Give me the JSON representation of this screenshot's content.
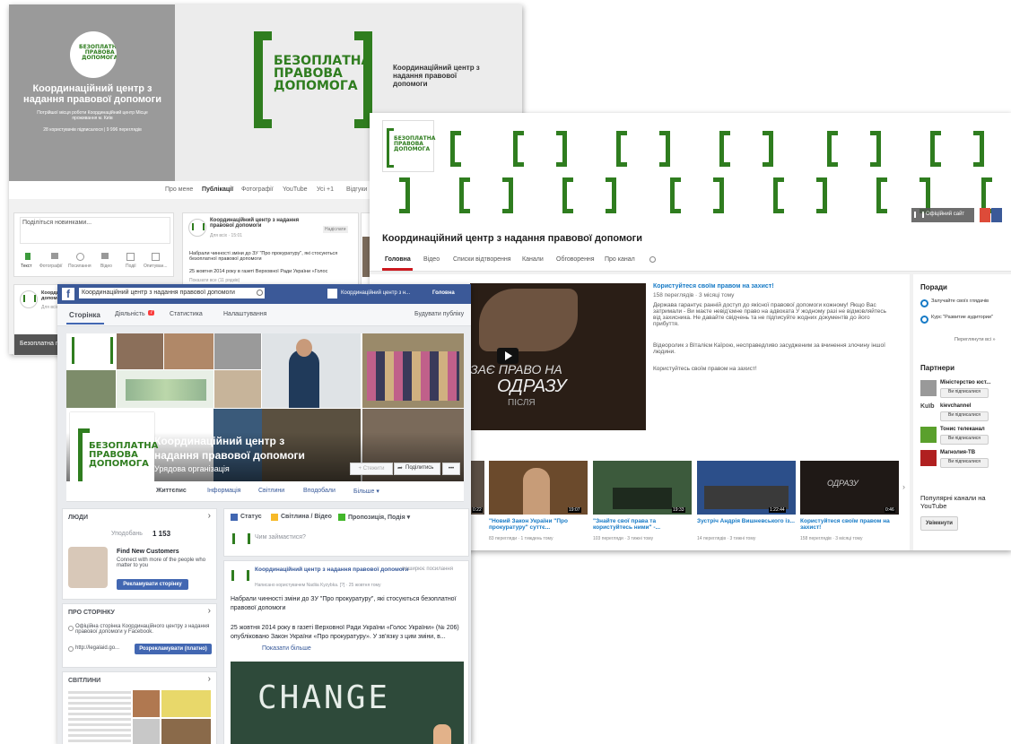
{
  "gplus": {
    "page_title": "Координаційний центр з надання правової допомоги",
    "desc": "Потрійшої місця роботи Координаційний центр Місце проживання м. Київ",
    "stats": "28 користувачів підписалося | 9 996 переглядів",
    "logo": [
      "БЕЗОПЛАТНА",
      "ПРАВОВА",
      "ДОПОМОГА"
    ],
    "banner_caption": "Координаційний центр з надання правової допомоги",
    "tabs": [
      "Про мене",
      "Публікації",
      "Фотографії",
      "YouTube",
      "Усі +1",
      "Відгуки"
    ],
    "share_placeholder": "Поділіться новинками...",
    "share_tools": [
      "Текст",
      "Фотографії",
      "Посилання",
      "Відео",
      "Події",
      "Опитуван..."
    ],
    "post_author": "Координаційний центр з надання правової допомоги",
    "post_meta": "Для всіх · 15:01",
    "post_badge": "Надіслати",
    "post_text1": "Набрали чинності зміни до ЗУ \"Про прокуратуру\", які стосуються безоплатної правової допомоги",
    "post_text2": "25 жовтня 2014 року в газеті Верховної Ради України «Голос",
    "post_more": "Показати все (11 рядків)",
    "side_item": "Координаційний центр з надання правової допомоги",
    "side_meta": "Для всіх",
    "side_caption": "Безоплатна пр..."
  },
  "youtube": {
    "channel_title": "Координаційний центр з надання правової допомоги",
    "official_site": "Офіційний сайт",
    "tabs": [
      "Головна",
      "Відео",
      "Списки відтворення",
      "Канали",
      "Обговорення",
      "Про канал"
    ],
    "video_title": "Користуйтеся своїм правом на захист!",
    "video_meta": "158 переглядів · 3 місяці тому",
    "video_desc1": "Держава гарантує ранній доступ до якісної правової допомоги кожному! Якщо Вас затримали - Ви маєте невід'ємне право на адвоката У жодному разі не відмовляйтесь від захисника. Не давайте свідчень та не підписуйте жодних документів до його прибуття.",
    "video_desc2": "Відеоролик з Віталієм Каїрою, несправедливо засудженим за вчинення злочину іншої людини.",
    "video_desc3": "Користуйтесь своїм правом на захист!",
    "player_overlay": [
      "ЗАЄ ПРАВО НА",
      "ОДРАЗУ",
      "ПІСЛЯ"
    ],
    "thumbs": [
      {
        "title": "\"Новий Закон України \"Про прокуратуру\" суттє...",
        "meta": "83 перегляди · 1 тиждень тому",
        "duration": "19:07"
      },
      {
        "title": "\"Знайте свої права та користуйтесь ними\" -...",
        "meta": "103 перегляди · 3 тижні тому",
        "duration": "19:33"
      },
      {
        "title": "Зустріч Андрія Вишневського із...",
        "meta": "14 переглядів · 3 тижні тому",
        "duration": "1:22:44"
      },
      {
        "title": "Користуйтеся своїм правом на захист!",
        "meta": "158 переглядів · 3 місяці тому",
        "duration": "0:46"
      }
    ],
    "first_thumb_duration": "0:22",
    "tips_title": "Поради",
    "tips": [
      "Залучайте своїх глядачів",
      "Курс \"Развитие аудитории\""
    ],
    "tips_more": "Переглянути всі »",
    "partners_title": "Партнери",
    "partners": [
      {
        "name": "Міністерство юст...",
        "btn": "Ви підписалися"
      },
      {
        "name": "kievchannel",
        "btn": "Ви підписалися"
      },
      {
        "name": "Тонис телеканал",
        "btn": "Ви підписалися"
      },
      {
        "name": "Магнолия-ТВ",
        "btn": "Ви підписалися"
      }
    ],
    "popular_title": "Популярні канали на YouTube",
    "popular_btn": "Увімкнути"
  },
  "facebook": {
    "search_value": "Координаційний центр з надання правової допомоги",
    "header_page": "Координаційний центр з н...",
    "header_home": "Головна",
    "admin_tabs": [
      "Сторінка",
      "Діяльність",
      "Статистика",
      "Налаштування"
    ],
    "activity_badge": "7",
    "admin_right": "Будувати публіку",
    "cover_name_line1": "Координаційний центр з",
    "cover_name_line2": "надання правової допомоги",
    "cover_category": "Урядова організація",
    "cover_btn_like": "+ Стежити",
    "cover_btn_share": "Поділитись",
    "cover_btn_more": "•••",
    "nav_tabs": [
      "Життєпис",
      "Інформація",
      "Світлини",
      "Вподобали",
      "Більше ▾"
    ],
    "people_title": "ЛЮДИ",
    "likes_label": "Уподобань",
    "likes_count": "1 153",
    "promo_title": "Find New Customers",
    "promo_text": "Connect with more of the people who matter to you",
    "promo_btn": "Рекламувати сторінку",
    "about_title": "ПРО СТОРІНКУ",
    "about_text": "Офіційна сторінка Координаційного центру з надання правової допомоги у Facebook.",
    "about_url": "http://legalaid.go...",
    "about_btn": "Розрекламувати (платно)",
    "photos_title": "СВІТЛИНИ",
    "composer_tabs": [
      "Статус",
      "Світлина / Відео",
      "Пропозиція, Подія ▾"
    ],
    "composer_placeholder": "Чим займаєтися?",
    "post_author": "Координаційний центр з надання правової допомоги",
    "post_shared": "поширює посилання",
    "post_meta": "Написано користувачем Nadiia Kyzybka. [?] · 25 жовтня тому",
    "post_text1": "Набрали чинності зміни до ЗУ \"Про прокуратуру\", які стосуються безоплатної правової допомоги",
    "post_text2": "25 жовтня 2014 року в газеті Верховної Ради України «Голос України» (№ 206) опубліковано Закон України «Про прокуратуру». У зв'язку з цим зміни, в...",
    "post_more": "Показати більше",
    "chalk_word": "CHANGE",
    "logo": [
      "БЕЗОПЛАТНА",
      "ПРАВОВА",
      "ДОПОМОГА"
    ]
  },
  "colors": {
    "brand_green": "#2f7d1f",
    "fb_blue": "#3b5998",
    "yt_red": "#cc181e"
  }
}
